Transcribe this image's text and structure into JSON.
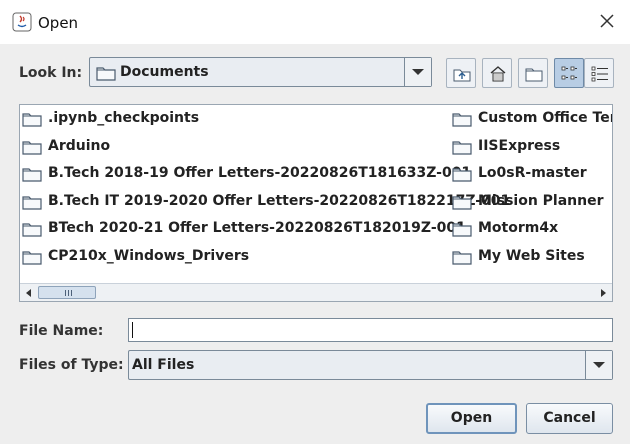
{
  "titlebar": {
    "title": "Open"
  },
  "look_in": {
    "label": "Look In:",
    "value": "Documents"
  },
  "toolbar": {
    "buttons": [
      {
        "name": "up-one-level",
        "icon": "folder-up-icon"
      },
      {
        "name": "home",
        "icon": "home-icon"
      },
      {
        "name": "create-new-folder",
        "icon": "new-folder-icon"
      },
      {
        "name": "list-view",
        "icon": "list-view-icon",
        "active": true
      },
      {
        "name": "details-view",
        "icon": "details-view-icon",
        "active": false
      }
    ]
  },
  "files": {
    "column1": [
      ".ipynb_checkpoints",
      "Arduino",
      "B.Tech 2018-19 Offer Letters-20220826T181633Z-001",
      "B.Tech IT 2019-2020 Offer Letters-20220826T182217Z-001",
      "BTech 2020-21 Offer Letters-20220826T182019Z-001",
      "CP210x_Windows_Drivers"
    ],
    "column2": [
      "Custom Office Tem",
      "IISExpress",
      "Lo0sR-master",
      "Mission Planner",
      "Motorm4x",
      "My Web Sites"
    ]
  },
  "file_name": {
    "label": "File Name:",
    "value": ""
  },
  "files_of_type": {
    "label": "Files of Type:",
    "value": "All Files"
  },
  "buttons": {
    "open": "Open",
    "cancel": "Cancel"
  },
  "colors": {
    "accent": "#6f94bb",
    "selected_toggle": "#b8cde4",
    "folder": "#5a6e85"
  }
}
